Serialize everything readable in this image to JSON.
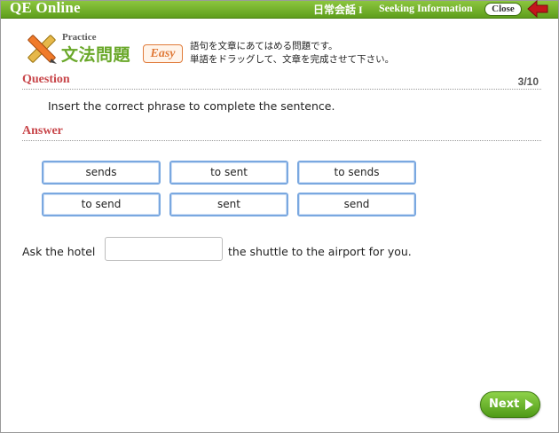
{
  "app": {
    "title": "QE Online",
    "course": "日常会話 I",
    "topic": "Seeking Information",
    "close_label": "Close"
  },
  "practice": {
    "label": "Practice",
    "title": "文法問題",
    "level": "Easy",
    "instruction_line1": "語句を文章にあてはめる問題です。",
    "instruction_line2": "単語をドラッグして、文章を完成させて下さい。"
  },
  "question": {
    "heading": "Question",
    "counter": "3/10",
    "prompt": "Insert the correct phrase to complete the sentence."
  },
  "answer": {
    "heading": "Answer",
    "choices": [
      "sends",
      "to sent",
      "to sends",
      "to send",
      "sent",
      "send"
    ],
    "sentence_before": "Ask the hotel",
    "sentence_after": "the shuttle to the airport for you."
  },
  "footer": {
    "next_label": "Next"
  },
  "colors": {
    "brand_green": "#6aa82a",
    "heading_red": "#c8464a",
    "choice_border": "#7aa8e0",
    "badge_orange": "#e07b3a"
  }
}
